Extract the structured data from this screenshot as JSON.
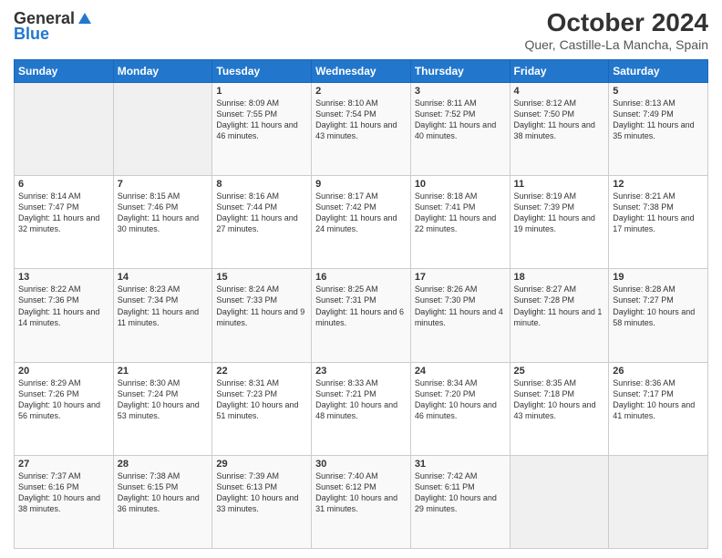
{
  "header": {
    "logo_general": "General",
    "logo_blue": "Blue",
    "month_title": "October 2024",
    "subtitle": "Quer, Castille-La Mancha, Spain"
  },
  "weekdays": [
    "Sunday",
    "Monday",
    "Tuesday",
    "Wednesday",
    "Thursday",
    "Friday",
    "Saturday"
  ],
  "weeks": [
    [
      {
        "day": "",
        "sunrise": "",
        "sunset": "",
        "daylight": ""
      },
      {
        "day": "",
        "sunrise": "",
        "sunset": "",
        "daylight": ""
      },
      {
        "day": "1",
        "sunrise": "Sunrise: 8:09 AM",
        "sunset": "Sunset: 7:55 PM",
        "daylight": "Daylight: 11 hours and 46 minutes."
      },
      {
        "day": "2",
        "sunrise": "Sunrise: 8:10 AM",
        "sunset": "Sunset: 7:54 PM",
        "daylight": "Daylight: 11 hours and 43 minutes."
      },
      {
        "day": "3",
        "sunrise": "Sunrise: 8:11 AM",
        "sunset": "Sunset: 7:52 PM",
        "daylight": "Daylight: 11 hours and 40 minutes."
      },
      {
        "day": "4",
        "sunrise": "Sunrise: 8:12 AM",
        "sunset": "Sunset: 7:50 PM",
        "daylight": "Daylight: 11 hours and 38 minutes."
      },
      {
        "day": "5",
        "sunrise": "Sunrise: 8:13 AM",
        "sunset": "Sunset: 7:49 PM",
        "daylight": "Daylight: 11 hours and 35 minutes."
      }
    ],
    [
      {
        "day": "6",
        "sunrise": "Sunrise: 8:14 AM",
        "sunset": "Sunset: 7:47 PM",
        "daylight": "Daylight: 11 hours and 32 minutes."
      },
      {
        "day": "7",
        "sunrise": "Sunrise: 8:15 AM",
        "sunset": "Sunset: 7:46 PM",
        "daylight": "Daylight: 11 hours and 30 minutes."
      },
      {
        "day": "8",
        "sunrise": "Sunrise: 8:16 AM",
        "sunset": "Sunset: 7:44 PM",
        "daylight": "Daylight: 11 hours and 27 minutes."
      },
      {
        "day": "9",
        "sunrise": "Sunrise: 8:17 AM",
        "sunset": "Sunset: 7:42 PM",
        "daylight": "Daylight: 11 hours and 24 minutes."
      },
      {
        "day": "10",
        "sunrise": "Sunrise: 8:18 AM",
        "sunset": "Sunset: 7:41 PM",
        "daylight": "Daylight: 11 hours and 22 minutes."
      },
      {
        "day": "11",
        "sunrise": "Sunrise: 8:19 AM",
        "sunset": "Sunset: 7:39 PM",
        "daylight": "Daylight: 11 hours and 19 minutes."
      },
      {
        "day": "12",
        "sunrise": "Sunrise: 8:21 AM",
        "sunset": "Sunset: 7:38 PM",
        "daylight": "Daylight: 11 hours and 17 minutes."
      }
    ],
    [
      {
        "day": "13",
        "sunrise": "Sunrise: 8:22 AM",
        "sunset": "Sunset: 7:36 PM",
        "daylight": "Daylight: 11 hours and 14 minutes."
      },
      {
        "day": "14",
        "sunrise": "Sunrise: 8:23 AM",
        "sunset": "Sunset: 7:34 PM",
        "daylight": "Daylight: 11 hours and 11 minutes."
      },
      {
        "day": "15",
        "sunrise": "Sunrise: 8:24 AM",
        "sunset": "Sunset: 7:33 PM",
        "daylight": "Daylight: 11 hours and 9 minutes."
      },
      {
        "day": "16",
        "sunrise": "Sunrise: 8:25 AM",
        "sunset": "Sunset: 7:31 PM",
        "daylight": "Daylight: 11 hours and 6 minutes."
      },
      {
        "day": "17",
        "sunrise": "Sunrise: 8:26 AM",
        "sunset": "Sunset: 7:30 PM",
        "daylight": "Daylight: 11 hours and 4 minutes."
      },
      {
        "day": "18",
        "sunrise": "Sunrise: 8:27 AM",
        "sunset": "Sunset: 7:28 PM",
        "daylight": "Daylight: 11 hours and 1 minute."
      },
      {
        "day": "19",
        "sunrise": "Sunrise: 8:28 AM",
        "sunset": "Sunset: 7:27 PM",
        "daylight": "Daylight: 10 hours and 58 minutes."
      }
    ],
    [
      {
        "day": "20",
        "sunrise": "Sunrise: 8:29 AM",
        "sunset": "Sunset: 7:26 PM",
        "daylight": "Daylight: 10 hours and 56 minutes."
      },
      {
        "day": "21",
        "sunrise": "Sunrise: 8:30 AM",
        "sunset": "Sunset: 7:24 PM",
        "daylight": "Daylight: 10 hours and 53 minutes."
      },
      {
        "day": "22",
        "sunrise": "Sunrise: 8:31 AM",
        "sunset": "Sunset: 7:23 PM",
        "daylight": "Daylight: 10 hours and 51 minutes."
      },
      {
        "day": "23",
        "sunrise": "Sunrise: 8:33 AM",
        "sunset": "Sunset: 7:21 PM",
        "daylight": "Daylight: 10 hours and 48 minutes."
      },
      {
        "day": "24",
        "sunrise": "Sunrise: 8:34 AM",
        "sunset": "Sunset: 7:20 PM",
        "daylight": "Daylight: 10 hours and 46 minutes."
      },
      {
        "day": "25",
        "sunrise": "Sunrise: 8:35 AM",
        "sunset": "Sunset: 7:18 PM",
        "daylight": "Daylight: 10 hours and 43 minutes."
      },
      {
        "day": "26",
        "sunrise": "Sunrise: 8:36 AM",
        "sunset": "Sunset: 7:17 PM",
        "daylight": "Daylight: 10 hours and 41 minutes."
      }
    ],
    [
      {
        "day": "27",
        "sunrise": "Sunrise: 7:37 AM",
        "sunset": "Sunset: 6:16 PM",
        "daylight": "Daylight: 10 hours and 38 minutes."
      },
      {
        "day": "28",
        "sunrise": "Sunrise: 7:38 AM",
        "sunset": "Sunset: 6:15 PM",
        "daylight": "Daylight: 10 hours and 36 minutes."
      },
      {
        "day": "29",
        "sunrise": "Sunrise: 7:39 AM",
        "sunset": "Sunset: 6:13 PM",
        "daylight": "Daylight: 10 hours and 33 minutes."
      },
      {
        "day": "30",
        "sunrise": "Sunrise: 7:40 AM",
        "sunset": "Sunset: 6:12 PM",
        "daylight": "Daylight: 10 hours and 31 minutes."
      },
      {
        "day": "31",
        "sunrise": "Sunrise: 7:42 AM",
        "sunset": "Sunset: 6:11 PM",
        "daylight": "Daylight: 10 hours and 29 minutes."
      },
      {
        "day": "",
        "sunrise": "",
        "sunset": "",
        "daylight": ""
      },
      {
        "day": "",
        "sunrise": "",
        "sunset": "",
        "daylight": ""
      }
    ]
  ]
}
